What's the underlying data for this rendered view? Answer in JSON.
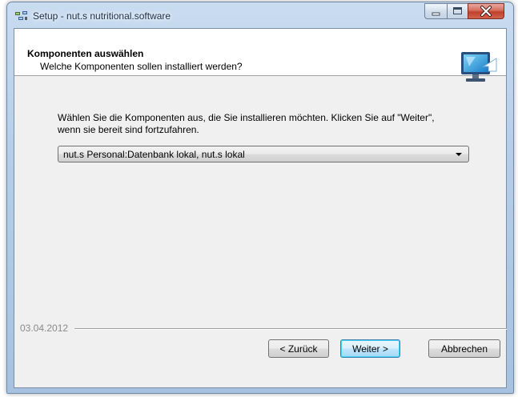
{
  "window": {
    "title": "Setup - nut.s nutritional.software"
  },
  "header": {
    "title": "Komponenten auswählen",
    "subtitle": "Welche Komponenten sollen installiert werden?"
  },
  "main": {
    "instruction": "Wählen Sie die Komponenten aus, die Sie installieren möchten. Klicken Sie auf \"Weiter\", wenn sie bereit sind fortzufahren.",
    "components_select": {
      "value": "nut.s Personal:Datenbank lokal, nut.s lokal"
    }
  },
  "footer": {
    "date": "03.04.2012",
    "back_label": "< Zurück",
    "next_label": "Weiter >",
    "cancel_label": "Abbrechen"
  },
  "icons": {
    "app": "setup-app-icon",
    "header": "computer-install-arrow-icon",
    "minimize": "minimize-icon",
    "maximize": "maximize-icon",
    "close": "close-icon",
    "dropdown": "chevron-down-icon"
  },
  "colors": {
    "title_bar": "#b5cde8",
    "client_bg": "#f0f0f0",
    "close_button": "#c1402c",
    "default_button_border": "#3c7fb1",
    "date_text": "#8a8a8a"
  }
}
